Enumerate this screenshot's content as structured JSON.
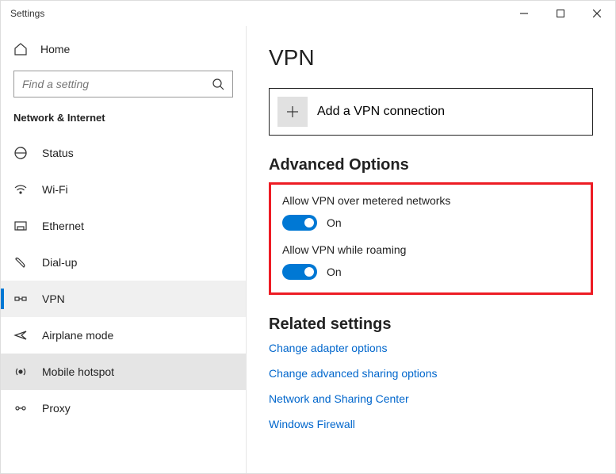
{
  "window": {
    "title": "Settings"
  },
  "sidebar": {
    "home_label": "Home",
    "search_placeholder": "Find a setting",
    "section_title": "Network & Internet",
    "items": [
      {
        "label": "Status"
      },
      {
        "label": "Wi-Fi"
      },
      {
        "label": "Ethernet"
      },
      {
        "label": "Dial-up"
      },
      {
        "label": "VPN"
      },
      {
        "label": "Airplane mode"
      },
      {
        "label": "Mobile hotspot"
      },
      {
        "label": "Proxy"
      }
    ]
  },
  "main": {
    "title": "VPN",
    "add_label": "Add a VPN connection",
    "advanced_heading": "Advanced Options",
    "toggles": [
      {
        "label": "Allow VPN over metered networks",
        "state": "On"
      },
      {
        "label": "Allow VPN while roaming",
        "state": "On"
      }
    ],
    "related_heading": "Related settings",
    "links": [
      "Change adapter options",
      "Change advanced sharing options",
      "Network and Sharing Center",
      "Windows Firewall"
    ]
  }
}
